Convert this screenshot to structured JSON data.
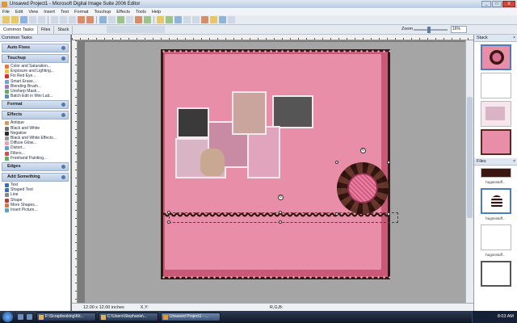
{
  "window": {
    "title": "Unsaved Project1 - Microsoft Digital Image Suite 2006 Editor",
    "buttons": [
      "_",
      "□",
      "X"
    ]
  },
  "menubar": [
    "File",
    "Edit",
    "View",
    "Insert",
    "Text",
    "Format",
    "Touchup",
    "Effects",
    "Tools",
    "Help"
  ],
  "toolbar2": {
    "tabs": [
      "Common Tasks",
      "Files",
      "Stack"
    ],
    "zoom_label": "Zoom",
    "zoom_value": "16%",
    "zoom_level": 0.4
  },
  "left_panel": {
    "header": "Common Tasks",
    "sections": [
      {
        "title": "Auto Fixes",
        "items": []
      },
      {
        "title": "Touchup",
        "items": [
          "Color and Saturation...",
          "Exposure and Lighting...",
          "Fix Red Eye...",
          "Smart Erase...",
          "Blending Brush...",
          "Unsharp Mask...",
          "Batch Edit in Mini Lab..."
        ]
      },
      {
        "title": "Format",
        "items": []
      },
      {
        "title": "Effects",
        "items": [
          "Antique",
          "Black and White",
          "Negative",
          "Black and White Effects...",
          "Diffuse Glow...",
          "Distort...",
          "Filters...",
          "Freehand Painting..."
        ]
      },
      {
        "title": "Edges",
        "items": []
      },
      {
        "title": "Add Something",
        "items": [
          "Text",
          "Shaped Text",
          "Line",
          "Shape",
          "More Shapes...",
          "Insert Picture..."
        ]
      }
    ]
  },
  "statusbar": {
    "size": "12.00 x 12.00 inches",
    "xy": "X,Y:",
    "rgb": "R,G,B:"
  },
  "right_panel": {
    "stack_header": "Stack",
    "files_header": "Files",
    "files": [
      "hugsnstuff...",
      "hugsnstuff...",
      "hugsnstuff..."
    ]
  },
  "taskbar": {
    "buttons": [
      "F:\\Scrapbooking\\Kit...",
      "C:\\Users\\Stephanie\\...",
      "Unsaved Project1 - ..."
    ],
    "clock": "8:03 AM"
  },
  "colors": {
    "page_pink": "#e98ea8",
    "border_brown": "#2e1a16",
    "accent": "#4a7cc0"
  }
}
